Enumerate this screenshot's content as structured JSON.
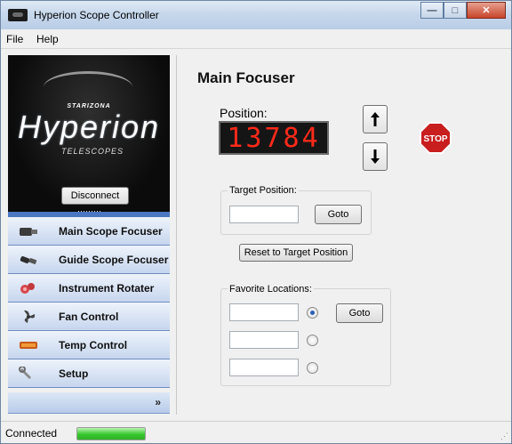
{
  "window": {
    "title": "Hyperion Scope Controller",
    "minimize": "—",
    "maximize": "□",
    "close": "✕"
  },
  "menu": [
    "File",
    "Help"
  ],
  "logo": {
    "brand_small": "STARIZONA",
    "brand_big": "Hyperion",
    "brand_sub": "TELESCOPES"
  },
  "sidebar": {
    "disconnect_label": "Disconnect",
    "items": [
      {
        "label": "Main Scope Focuser",
        "icon": "focuser-icon"
      },
      {
        "label": "Guide Scope Focuser",
        "icon": "guide-focuser-icon"
      },
      {
        "label": "Instrument Rotater",
        "icon": "rotator-icon"
      },
      {
        "label": "Fan Control",
        "icon": "fan-icon"
      },
      {
        "label": "Temp Control",
        "icon": "temperature-icon"
      },
      {
        "label": "Setup",
        "icon": "wrench-icon"
      }
    ],
    "more_glyph": "»"
  },
  "main": {
    "title": "Main Focuser",
    "position_label": "Position:",
    "position_value": "13784",
    "stop_label": "STOP",
    "target_group_title": "Target Position:",
    "target_value": "",
    "goto_label": "Goto",
    "reset_label": "Reset to Target Position",
    "favorites_title": "Favorite Locations:",
    "favorites": [
      {
        "value": "",
        "selected": true
      },
      {
        "value": "",
        "selected": false
      },
      {
        "value": "",
        "selected": false
      }
    ],
    "favorites_goto_label": "Goto"
  },
  "status": {
    "text": "Connected",
    "progress": 1.0,
    "colors": {
      "progress": "#37c82e"
    }
  }
}
